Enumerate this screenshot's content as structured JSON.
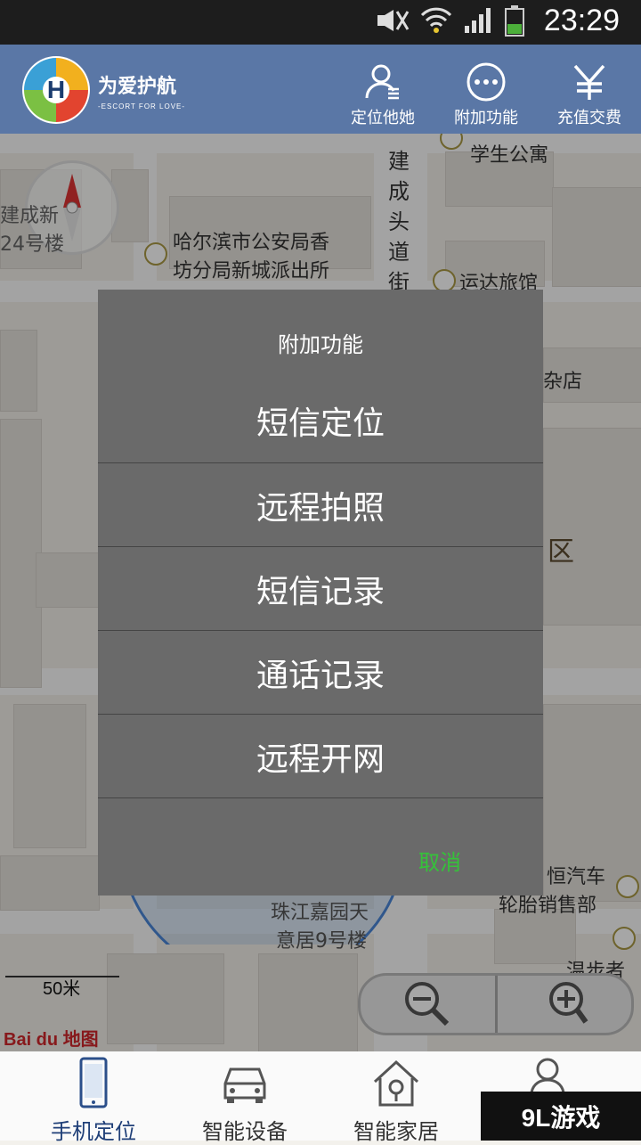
{
  "status_bar": {
    "time": "23:29",
    "icons": [
      "mute-icon",
      "wifi-icon",
      "signal-icon",
      "battery-icon"
    ]
  },
  "header": {
    "logo": {
      "title": "为爱护航",
      "subtitle": "-ESCORT FOR LOVE-"
    },
    "buttons": [
      {
        "label": "定位他她",
        "icon": "person-locate-icon"
      },
      {
        "label": "附加功能",
        "icon": "more-icon"
      },
      {
        "label": "充值交费",
        "icon": "yen-icon"
      }
    ]
  },
  "map": {
    "labels": [
      "学生公寓",
      "建成头道街",
      "哈尔滨市公安局香",
      "坊分局新城派出所",
      "运达旅馆",
      "杂店",
      "区",
      "恒汽车",
      "轮胎销售部",
      "珠江嘉园天",
      "意居9号楼",
      "建成新",
      "24号楼",
      "温步者"
    ],
    "scale_label": "50米",
    "provider": "Bai du 地图"
  },
  "dialog": {
    "title": "附加功能",
    "items": [
      "短信定位",
      "远程拍照",
      "短信记录",
      "通话记录",
      "远程开网"
    ],
    "cancel": "取消"
  },
  "bottom_nav": {
    "items": [
      {
        "label": "手机定位",
        "icon": "phone-icon",
        "active": true
      },
      {
        "label": "智能设备",
        "icon": "car-icon",
        "active": false
      },
      {
        "label": "智能家居",
        "icon": "home-icon",
        "active": false
      },
      {
        "label": "",
        "icon": "person-icon",
        "active": false
      }
    ]
  },
  "watermark": "9L游戏",
  "colors": {
    "header": "#5a77a6",
    "dialog": "#6a6a6a",
    "cancel": "#35c23a",
    "nav_active": "#1f3f78"
  }
}
